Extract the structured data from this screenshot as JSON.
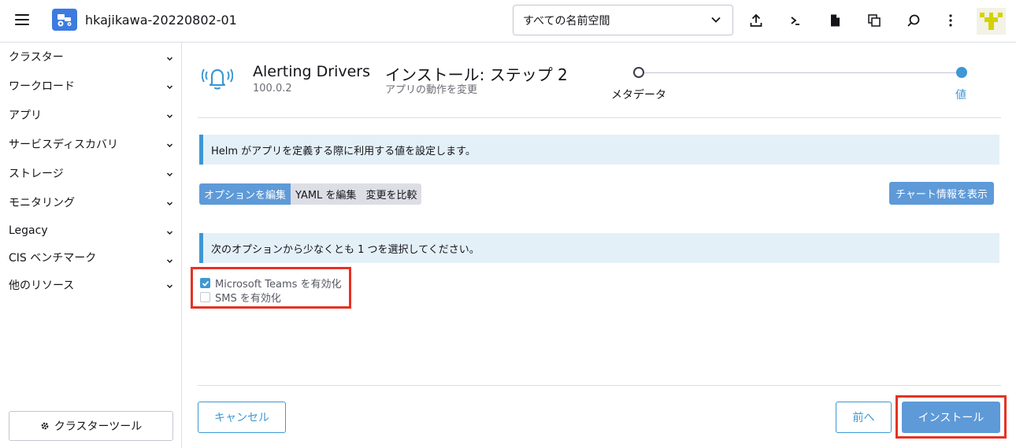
{
  "header": {
    "cluster_name": "hkajikawa-20220802-01",
    "namespace_select": "すべての名前空間",
    "icons": [
      "import-yaml-icon",
      "kubectl-shell-icon",
      "kubeconfig-file-icon",
      "copy-kubeconfig-icon",
      "search-icon",
      "more-vert-icon"
    ]
  },
  "sidebar": {
    "items": [
      {
        "label": "クラスター"
      },
      {
        "label": "ワークロード"
      },
      {
        "label": "アプリ"
      },
      {
        "label": "サービスディスカバリ"
      },
      {
        "label": "ストレージ"
      },
      {
        "label": "モニタリング"
      },
      {
        "label": "Legacy"
      },
      {
        "label": "CIS ベンチマーク"
      },
      {
        "label": "他のリソース"
      }
    ],
    "cluster_tools": "クラスターツール"
  },
  "app": {
    "name": "Alerting Drivers",
    "version": "100.0.2",
    "step_title": "インストール: ステップ 2",
    "step_subtitle": "アプリの動作を変更"
  },
  "stepper": {
    "steps": [
      {
        "label": "メタデータ",
        "state": "done"
      },
      {
        "label": "値",
        "state": "active"
      }
    ]
  },
  "banners": {
    "helm_info": "Helm がアプリを定義する際に利用する値を設定します。",
    "select_option": "次のオプションから少なくとも 1 つを選択してください。"
  },
  "tabs": [
    {
      "label": "オプションを編集",
      "active": true
    },
    {
      "label": "YAML を編集",
      "active": false
    },
    {
      "label": "変更を比較",
      "active": false
    }
  ],
  "chart_info_button": "チャート情報を表示",
  "options": [
    {
      "label": "Microsoft Teams を有効化",
      "checked": true
    },
    {
      "label": "SMS を有効化",
      "checked": false
    }
  ],
  "footer": {
    "cancel": "キャンセル",
    "previous": "前へ",
    "install": "インストール"
  },
  "colors": {
    "accent": "#3d98d3",
    "button_primary": "#5e9ad8",
    "highlight": "#e53323",
    "banner_bg": "#e4f0f8"
  }
}
